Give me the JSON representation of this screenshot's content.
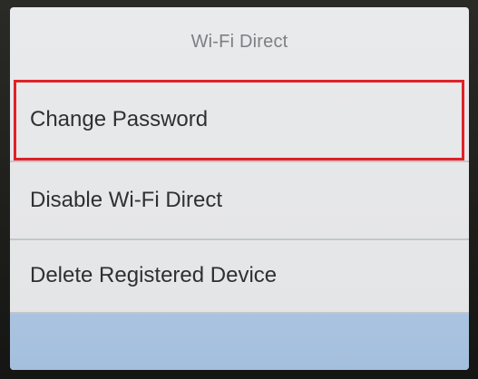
{
  "header": {
    "title": "Wi-Fi Direct"
  },
  "menu": {
    "items": [
      {
        "label": "Change Password",
        "selected": true
      },
      {
        "label": "Disable Wi-Fi Direct",
        "selected": false
      },
      {
        "label": "Delete Registered Device",
        "selected": false
      }
    ]
  },
  "colors": {
    "highlight_border": "#e02128",
    "footer_bar": "#a9c2df",
    "screen_bg": "#e8e9eb"
  }
}
